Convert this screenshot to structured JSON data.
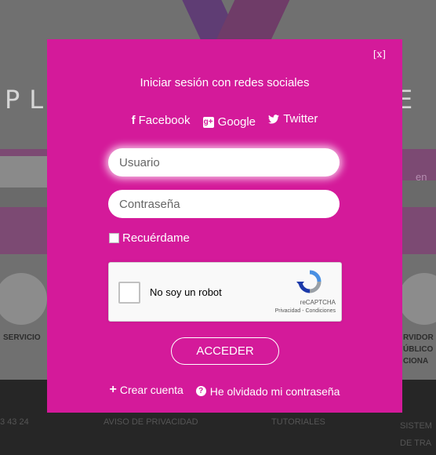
{
  "background": {
    "brand_word_left": "PLA",
    "brand_word_right": "E",
    "band_fragment": "en",
    "service_left": "SERVICIO",
    "service_right_lines": [
      "RVIDOR",
      "ÚBLICO",
      "CIONA"
    ],
    "footer": {
      "phone_fragment": "3 43 24",
      "privacy": "AVISO DE PRIVACIDAD",
      "tutorials": "TUTORIALES",
      "system_lines": [
        "SISTEM",
        "DE TRA"
      ]
    }
  },
  "modal": {
    "close_label": "[x]",
    "title": "Iniciar sesión con redes sociales",
    "social": {
      "facebook_icon": "f",
      "facebook_label": "Facebook",
      "google_icon": "g+",
      "google_label": "Google",
      "twitter_label": "Twitter"
    },
    "username_placeholder": "Usuario",
    "password_placeholder": "Contraseña",
    "remember_label": "Recuérdame",
    "recaptcha": {
      "label": "No soy un robot",
      "brand": "reCAPTCHA",
      "terms": "Privacidad - Condiciones"
    },
    "submit_label": "ACCEDER",
    "create_account_icon": "+",
    "create_account_label": "Crear cuenta",
    "forgot_icon": "?",
    "forgot_password_label": "He olvidado mi contraseña"
  },
  "colors": {
    "modal_bg": "#d41a9a",
    "overlay": "#6a6a6a",
    "text": "#ffffff"
  }
}
